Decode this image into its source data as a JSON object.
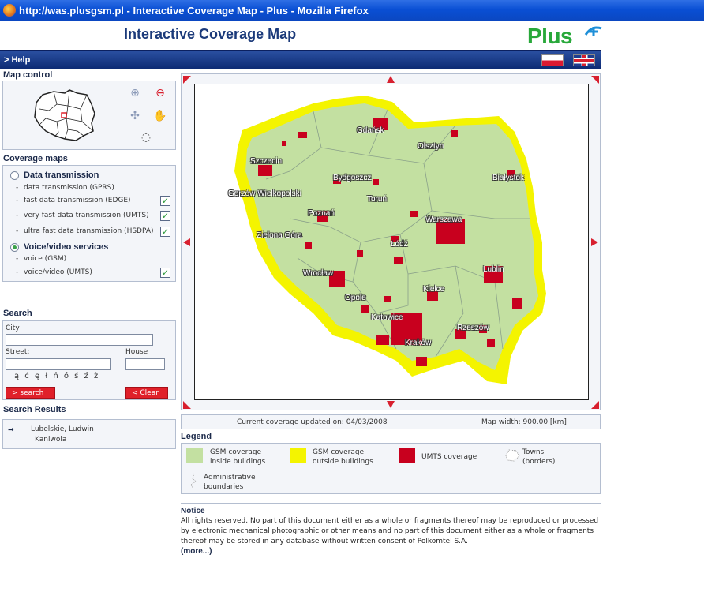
{
  "browser": {
    "title": "http://was.plusgsm.pl - Interactive Coverage Map - Plus - Mozilla Firefox",
    "icon": "firefox-icon"
  },
  "header": {
    "title": "Interactive Coverage Map",
    "logo_text": "Plus",
    "logo_color": "#28a83a"
  },
  "nav": {
    "help": "> Help",
    "languages": [
      "polish-flag-icon",
      "uk-flag-icon"
    ]
  },
  "map_control": {
    "title": "Map control",
    "tools": [
      "zoom-in-icon",
      "zoom-out-icon",
      "pan-icon",
      "hand-icon",
      "lasso-icon"
    ]
  },
  "coverage_maps": {
    "title": "Coverage maps",
    "groups": [
      {
        "label": "Data transmission",
        "selected": false,
        "items": [
          {
            "label": "data transmission (GPRS)",
            "checked": false
          },
          {
            "label": "fast data transmission (EDGE)",
            "checked": true
          },
          {
            "label": "very fast data transmission (UMTS)",
            "checked": true
          },
          {
            "label": "ultra fast data transmission (HSDPA)",
            "checked": true
          }
        ]
      },
      {
        "label": "Voice/video services",
        "selected": true,
        "items": [
          {
            "label": "voice (GSM)",
            "checked": false
          },
          {
            "label": "voice/video (UMTS)",
            "checked": true
          }
        ]
      }
    ]
  },
  "search": {
    "title": "Search",
    "city_label": "City",
    "city_value": "",
    "street_label": "Street:",
    "street_value": "",
    "house_label": "House",
    "house_value": "",
    "special_chars": "ą ć ę ł ń ó ś ź ż",
    "search_button": "> search",
    "clear_button": "< Clear"
  },
  "search_results": {
    "title": "Search Results",
    "arrow": "➡",
    "line1": "Lubelskie, Ludwin",
    "line2": "Kaniwola"
  },
  "map": {
    "cities": [
      "Gdańsk",
      "Olsztyn",
      "Szczecin",
      "Bydgoszcz",
      "Białystok",
      "Gorzów Wielkopolski",
      "Toruń",
      "Warszawa",
      "Poznań",
      "Zielona Góra",
      "Łódź",
      "Wrocław",
      "Lublin",
      "Kielce",
      "Opole",
      "Katowice",
      "Rzeszów",
      "Kraków"
    ],
    "colors": {
      "gsm_inside": "#c3e0a1",
      "gsm_outside": "#f4f400",
      "umts": "#c8001e",
      "nav_arrows": "#d8202f"
    }
  },
  "info": {
    "updated": "Current coverage updated on: 04/03/2008",
    "width": "Map width: 900.00 [km]"
  },
  "legend": {
    "title": "Legend",
    "items": [
      {
        "line1": "GSM coverage",
        "line2": "inside buildings",
        "color": "#c3e0a1"
      },
      {
        "line1": "GSM coverage",
        "line2": "outside buildings",
        "color": "#f4f400"
      },
      {
        "line1": "UMTS coverage",
        "line2": "",
        "color": "#c8001e"
      },
      {
        "line1": "Towns",
        "line2": "(borders)",
        "color": "#ffffff"
      },
      {
        "line1": "Administrative",
        "line2": "boundaries",
        "color": "#ffffff"
      }
    ]
  },
  "notice": {
    "title": "Notice",
    "text": "All rights reserved. No part of this document either as a whole or fragments thereof may be reproduced or processed by electronic mechanical photographic or other means and no part of this document either as a whole or fragments thereof may be stored in any database without written consent of Polkomtel S.A.",
    "more": "(more...)"
  }
}
